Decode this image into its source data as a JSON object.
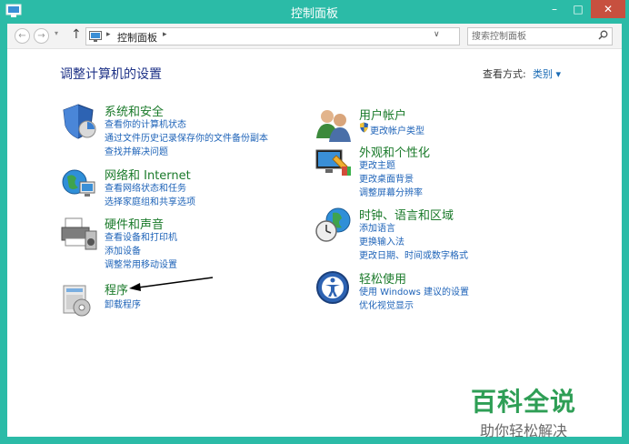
{
  "window": {
    "title": "控制面板",
    "minimize": "–",
    "maximize": "□",
    "close": "✕"
  },
  "addressbar": {
    "back": "←",
    "forward": "→",
    "recent": "▾",
    "up": "↑",
    "crumb_sep": "▸",
    "path": "控制面板",
    "dropdown": "∨",
    "refresh": "↻",
    "search_placeholder": "搜索控制面板"
  },
  "header": {
    "title": "调整计算机的设置",
    "view_label": "查看方式:",
    "view_value": "类别 ▾"
  },
  "categories": [
    {
      "title": "系统和安全",
      "links": [
        "查看你的计算机状态",
        "通过文件历史记录保存你的文件备份副本",
        "查找并解决问题"
      ]
    },
    {
      "title": "网络和 Internet",
      "links": [
        "查看网络状态和任务",
        "选择家庭组和共享选项"
      ]
    },
    {
      "title": "硬件和声音",
      "links": [
        "查看设备和打印机",
        "添加设备",
        "调整常用移动设置"
      ]
    },
    {
      "title": "程序",
      "links": [
        "卸载程序"
      ]
    },
    {
      "title": "用户帐户",
      "links": [
        "更改帐户类型"
      ]
    },
    {
      "title": "外观和个性化",
      "links": [
        "更改主题",
        "更改桌面背景",
        "调整屏幕分辨率"
      ]
    },
    {
      "title": "时钟、语言和区域",
      "links": [
        "添加语言",
        "更换输入法",
        "更改日期、时间或数字格式"
      ]
    },
    {
      "title": "轻松使用",
      "links": [
        "使用 Windows 建议的设置",
        "优化视觉显示"
      ]
    }
  ],
  "watermark": {
    "main": "百科全说",
    "sub": "助你轻松解决"
  }
}
